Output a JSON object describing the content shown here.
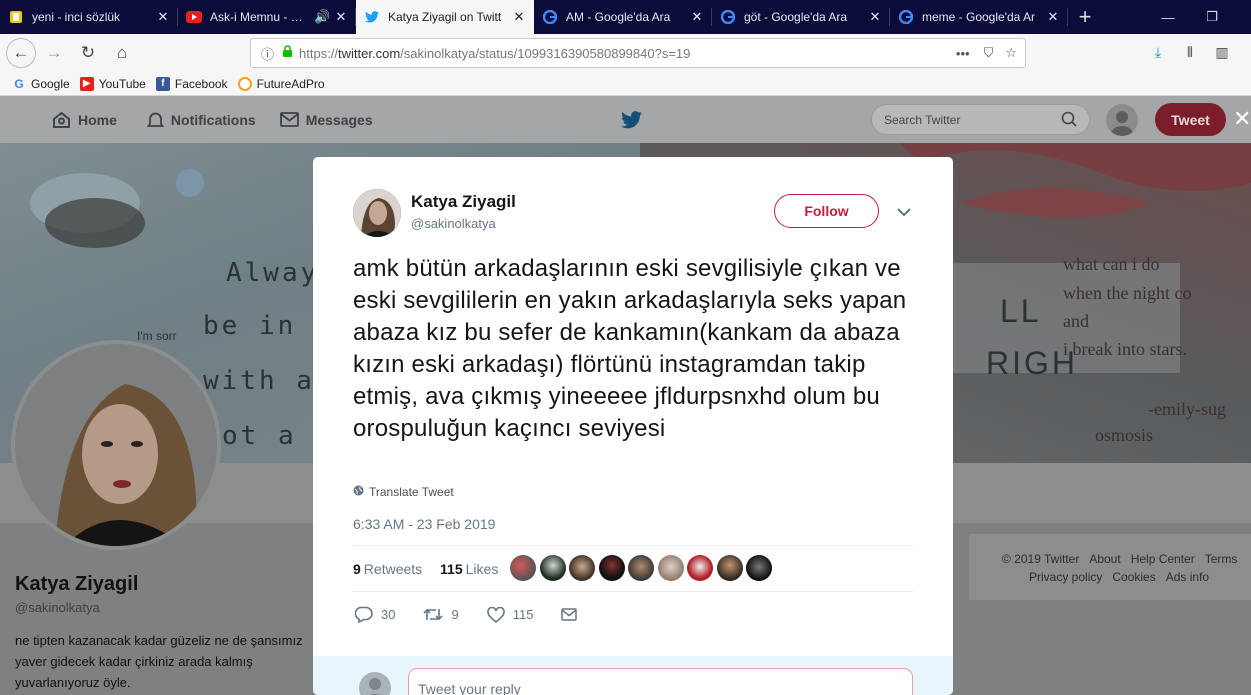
{
  "tabs": [
    {
      "label": "yeni - inci sözlük",
      "icon": "inci-sozluk-icon"
    },
    {
      "label": "Ask-i Memnu - Jen",
      "icon": "youtube-icon"
    },
    {
      "label": "Katya Ziyagil on Twitt",
      "icon": "twitter-icon"
    },
    {
      "label": "AM - Google'da Ara",
      "icon": "google-icon"
    },
    {
      "label": "göt - Google'da Ara",
      "icon": "google-icon"
    },
    {
      "label": "meme - Google'da Ar",
      "icon": "google-icon"
    }
  ],
  "url": {
    "prefix": "https://",
    "host": "twitter.com",
    "path": "/sakinolkatya/status/1099316390580899840?s=19"
  },
  "bookmarks": [
    "Google",
    "YouTube",
    "Facebook",
    "FutureAdPro"
  ],
  "twitter_nav": {
    "home": "Home",
    "notifications": "Notifications",
    "messages": "Messages",
    "search_placeholder": "Search Twitter",
    "tweet_button": "Tweet"
  },
  "banner": {
    "lines_left": [
      "Alway",
      "be in",
      "with a",
      "ot a"
    ],
    "im_sorry": "I'm sorr",
    "lines_right": [
      "what can i do",
      "when the night co",
      "and",
      "i break into stars.",
      "-emily-sug",
      "osmosis"
    ],
    "big_letters": [
      "LL",
      "RIGH"
    ]
  },
  "profile": {
    "name": "Katya Ziyagil",
    "handle": "@sakinolkatya",
    "bio": "ne tipten kazanacak kadar güzeliz ne de şansımız yaver gidecek kadar çirkiniz arada kalmış yuvarlanıyoruz öyle."
  },
  "footer": {
    "copyright": "© 2019 Twitter",
    "links": [
      "About",
      "Help Center",
      "Terms",
      "Privacy policy",
      "Cookies",
      "Ads info"
    ]
  },
  "tweet": {
    "name": "Katya Ziyagil",
    "handle": "@sakinolkatya",
    "follow_label": "Follow",
    "text": "amk bütün arkadaşlarının eski sevgilisiyle çıkan ve eski sevgililerin en yakın arkadaşlarıyla seks yapan abaza kız bu sefer de kankamın(kankam da abaza kızın eski arkadaşı) flörtünü instagramdan takip etmiş, ava çıkmış yineeeee jfldurpsnxhd olum bu orospuluğun kaçıncı seviyesi",
    "translate": "Translate Tweet",
    "timestamp": "6:33 AM - 23 Feb 2019",
    "retweets": "9",
    "retweets_label": "Retweets",
    "likes": "115",
    "likes_label": "Likes",
    "replies_count": "30",
    "retweet_count": "9",
    "like_count": "115",
    "reply_placeholder": "Tweet your reply"
  },
  "colors": {
    "accent": "#c0213b",
    "twitter_blue": "#1da1f2",
    "tab_bar": "#0c0c3a"
  }
}
